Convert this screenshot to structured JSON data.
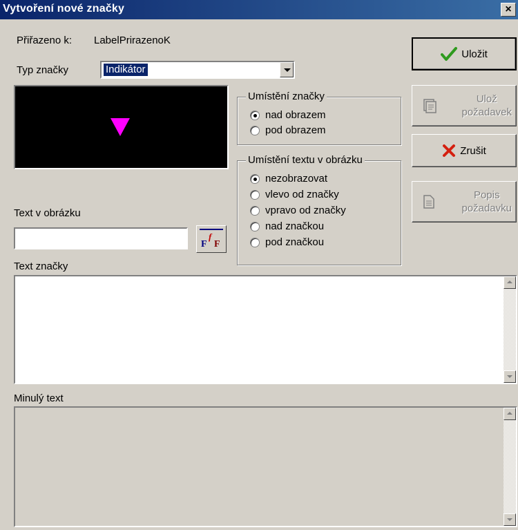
{
  "window": {
    "title": "Vytvoření nové značky",
    "close_glyph": "×"
  },
  "assigned": {
    "label": "Přiřazeno k:",
    "value": "LabelPrirazenoK"
  },
  "type": {
    "label": "Typ značky",
    "selected": "Indikátor"
  },
  "preview": {
    "marker_color": "#ff00ff",
    "background": "#000000"
  },
  "placement_group": {
    "title": "Umístění značky",
    "options": [
      "nad obrazem",
      "pod obrazem"
    ],
    "selected_index": 0
  },
  "text_position_group": {
    "title": "Umístění textu v obrázku",
    "options": [
      "nezobrazovat",
      "vlevo od značky",
      "vpravo od značky",
      "nad značkou",
      "pod značkou"
    ],
    "selected_index": 0
  },
  "image_text": {
    "label": "Text v obrázku",
    "value": ""
  },
  "buttons": {
    "save": {
      "label": "Uložit",
      "icon": "check-icon",
      "enabled": true
    },
    "save_request": {
      "label_line1": "Ulož",
      "label_line2": "požadavek",
      "icon": "save-request-icon",
      "enabled": false
    },
    "cancel": {
      "label": "Zrušit",
      "icon": "x-icon",
      "enabled": true
    },
    "request_description": {
      "label_line1": "Popis",
      "label_line2": "požadavku",
      "icon": "document-icon",
      "enabled": false
    }
  },
  "mark_text": {
    "label": "Text značky",
    "value": ""
  },
  "past_text": {
    "label": "Minulý text",
    "value": ""
  },
  "colors": {
    "title_start": "#0a246a",
    "title_end": "#3a6ea5",
    "check": "#2e9a1e",
    "cancel_x": "#d42010"
  }
}
